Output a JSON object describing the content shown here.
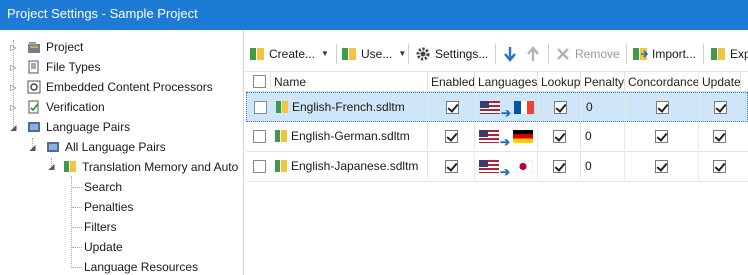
{
  "window": {
    "title": "Project Settings - Sample Project"
  },
  "tree": {
    "items": [
      {
        "label": "Project",
        "icon": "project-icon"
      },
      {
        "label": "File Types",
        "icon": "file-types-icon"
      },
      {
        "label": "Embedded Content Processors",
        "icon": "gear-icon"
      },
      {
        "label": "Verification",
        "icon": "verification-icon"
      },
      {
        "label": "Language Pairs",
        "icon": "language-pairs-icon"
      },
      {
        "label": "All Language Pairs",
        "icon": "language-pairs-icon"
      },
      {
        "label": "Translation Memory and Auto",
        "icon": "translation-memory-icon"
      },
      {
        "label": "Search"
      },
      {
        "label": "Penalties"
      },
      {
        "label": "Filters"
      },
      {
        "label": "Update"
      },
      {
        "label": "Language Resources"
      }
    ]
  },
  "toolbar": {
    "create": "Create...",
    "use": "Use...",
    "settings": "Settings...",
    "remove": "Remove",
    "import": "Import...",
    "export": "Exp"
  },
  "table": {
    "columns": [
      "Name",
      "Enabled",
      "Languages",
      "Lookup",
      "Penalty",
      "Concordance",
      "Update"
    ],
    "rows": [
      {
        "name": "English-French.sdltm",
        "enabled": true,
        "target_flag": "fr",
        "lookup": true,
        "penalty": "0",
        "concordance": true,
        "update": true,
        "selected": true
      },
      {
        "name": "English-German.sdltm",
        "enabled": true,
        "target_flag": "de",
        "lookup": true,
        "penalty": "0",
        "concordance": true,
        "update": true,
        "selected": false
      },
      {
        "name": "English-Japanese.sdltm",
        "enabled": true,
        "target_flag": "jp",
        "lookup": true,
        "penalty": "0",
        "concordance": true,
        "update": true,
        "selected": false
      }
    ]
  },
  "colors": {
    "titlebar": "#1d7bd6",
    "selection": "#cfe6f8",
    "accent": "#1d6fc2"
  }
}
